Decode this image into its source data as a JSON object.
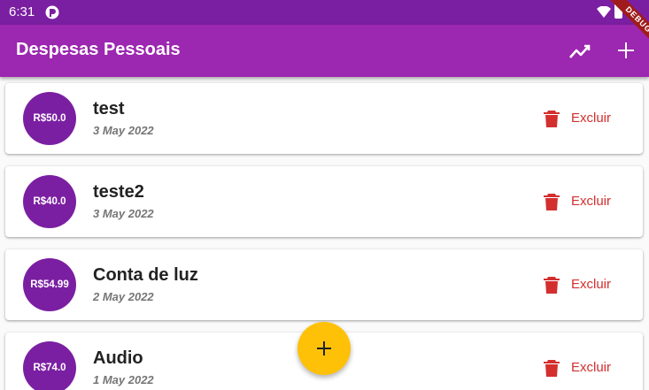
{
  "status_bar": {
    "time": "6:31",
    "app_icon": "app-notification-icon",
    "wifi_icon": "wifi-icon",
    "battery_icon": "battery-icon"
  },
  "app_bar": {
    "title": "Despesas Pessoais",
    "chart_icon": "trending-up-icon",
    "add_icon": "add-icon",
    "color": "#9c27b0"
  },
  "debug_banner": {
    "label": "DEBUG"
  },
  "transactions": [
    {
      "amount": "R$50.0",
      "title": "test",
      "date": "3 May 2022",
      "delete_label": "Excluir"
    },
    {
      "amount": "R$40.0",
      "title": "teste2",
      "date": "3 May 2022",
      "delete_label": "Excluir"
    },
    {
      "amount": "R$54.99",
      "title": "Conta de luz",
      "date": "2 May 2022",
      "delete_label": "Excluir"
    },
    {
      "amount": "R$74.0",
      "title": "Audio",
      "date": "1 May 2022",
      "delete_label": "Excluir"
    }
  ],
  "fab": {
    "icon": "add-icon",
    "color": "#ffc107"
  },
  "colors": {
    "avatar": "#7b1fa2",
    "delete": "#d32f2f",
    "status_bar": "#7b1fa2"
  }
}
